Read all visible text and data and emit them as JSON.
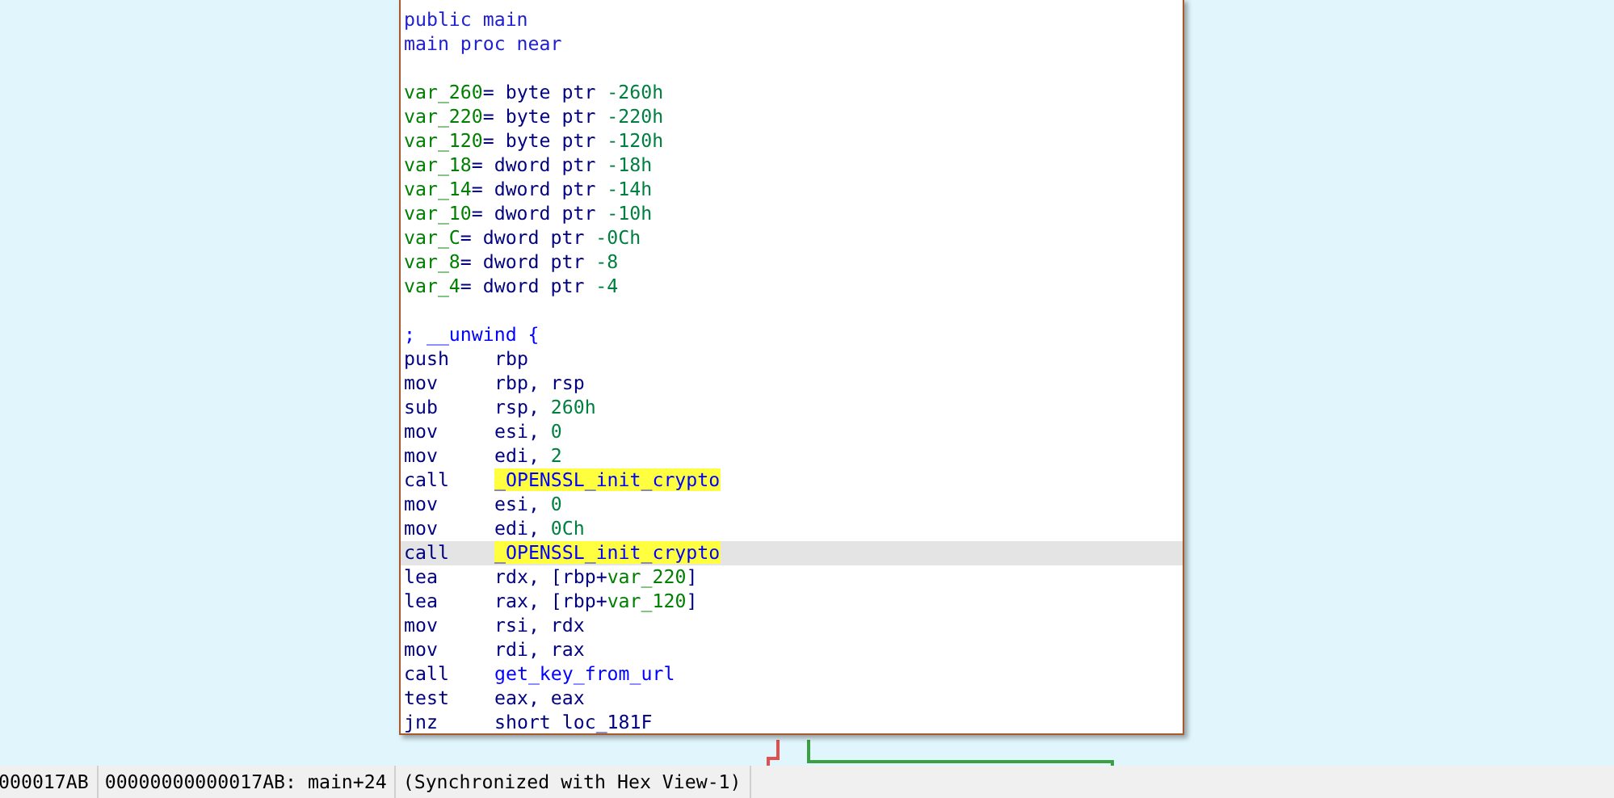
{
  "graph_node": {
    "lines": [
      {
        "kind": "text",
        "selected": false,
        "tokens": [
          {
            "text": "public main",
            "kind": "keyword"
          }
        ]
      },
      {
        "kind": "text",
        "selected": false,
        "tokens": [
          {
            "text": "main proc near",
            "kind": "keyword"
          }
        ]
      },
      {
        "kind": "blank",
        "selected": false
      },
      {
        "kind": "text",
        "selected": false,
        "tokens": [
          {
            "text": "var_260",
            "kind": "name"
          },
          {
            "text": "= byte ptr ",
            "kind": "plain"
          },
          {
            "text": "-260h",
            "kind": "number"
          }
        ]
      },
      {
        "kind": "text",
        "selected": false,
        "tokens": [
          {
            "text": "var_220",
            "kind": "name"
          },
          {
            "text": "= byte ptr ",
            "kind": "plain"
          },
          {
            "text": "-220h",
            "kind": "number"
          }
        ]
      },
      {
        "kind": "text",
        "selected": false,
        "tokens": [
          {
            "text": "var_120",
            "kind": "name"
          },
          {
            "text": "= byte ptr ",
            "kind": "plain"
          },
          {
            "text": "-120h",
            "kind": "number"
          }
        ]
      },
      {
        "kind": "text",
        "selected": false,
        "tokens": [
          {
            "text": "var_18",
            "kind": "name"
          },
          {
            "text": "= dword ptr ",
            "kind": "plain"
          },
          {
            "text": "-18h",
            "kind": "number"
          }
        ]
      },
      {
        "kind": "text",
        "selected": false,
        "tokens": [
          {
            "text": "var_14",
            "kind": "name"
          },
          {
            "text": "= dword ptr ",
            "kind": "plain"
          },
          {
            "text": "-14h",
            "kind": "number"
          }
        ]
      },
      {
        "kind": "text",
        "selected": false,
        "tokens": [
          {
            "text": "var_10",
            "kind": "name"
          },
          {
            "text": "= dword ptr ",
            "kind": "plain"
          },
          {
            "text": "-10h",
            "kind": "number"
          }
        ]
      },
      {
        "kind": "text",
        "selected": false,
        "tokens": [
          {
            "text": "var_C",
            "kind": "name"
          },
          {
            "text": "= dword ptr ",
            "kind": "plain"
          },
          {
            "text": "-0Ch",
            "kind": "number"
          }
        ]
      },
      {
        "kind": "text",
        "selected": false,
        "tokens": [
          {
            "text": "var_8",
            "kind": "name"
          },
          {
            "text": "= dword ptr ",
            "kind": "plain"
          },
          {
            "text": "-8",
            "kind": "number"
          }
        ]
      },
      {
        "kind": "text",
        "selected": false,
        "tokens": [
          {
            "text": "var_4",
            "kind": "name"
          },
          {
            "text": "= dword ptr ",
            "kind": "plain"
          },
          {
            "text": "-4",
            "kind": "number"
          }
        ]
      },
      {
        "kind": "blank",
        "selected": false
      },
      {
        "kind": "text",
        "selected": false,
        "tokens": [
          {
            "text": "; __unwind {",
            "kind": "comment"
          }
        ]
      },
      {
        "kind": "insn",
        "selected": false,
        "mnemonic": "push",
        "tokens": [
          {
            "text": "rbp",
            "kind": "plain"
          }
        ]
      },
      {
        "kind": "insn",
        "selected": false,
        "mnemonic": "mov",
        "tokens": [
          {
            "text": "rbp, rsp",
            "kind": "plain"
          }
        ]
      },
      {
        "kind": "insn",
        "selected": false,
        "mnemonic": "sub",
        "tokens": [
          {
            "text": "rsp, ",
            "kind": "plain"
          },
          {
            "text": "260h",
            "kind": "number"
          }
        ]
      },
      {
        "kind": "insn",
        "selected": false,
        "mnemonic": "mov",
        "tokens": [
          {
            "text": "esi, ",
            "kind": "plain"
          },
          {
            "text": "0",
            "kind": "number"
          }
        ]
      },
      {
        "kind": "insn",
        "selected": false,
        "mnemonic": "mov",
        "tokens": [
          {
            "text": "edi, ",
            "kind": "plain"
          },
          {
            "text": "2",
            "kind": "number"
          }
        ]
      },
      {
        "kind": "insn",
        "selected": false,
        "mnemonic": "call",
        "tokens": [
          {
            "text": "_OPENSSL_init_crypto",
            "kind": "highlighted"
          }
        ]
      },
      {
        "kind": "insn",
        "selected": false,
        "mnemonic": "mov",
        "tokens": [
          {
            "text": "esi, ",
            "kind": "plain"
          },
          {
            "text": "0",
            "kind": "number"
          }
        ]
      },
      {
        "kind": "insn",
        "selected": false,
        "mnemonic": "mov",
        "tokens": [
          {
            "text": "edi, ",
            "kind": "plain"
          },
          {
            "text": "0Ch",
            "kind": "number"
          }
        ]
      },
      {
        "kind": "insn",
        "selected": true,
        "mnemonic": "call",
        "tokens": [
          {
            "text": "_OPENSSL_init_crypto",
            "kind": "highlighted"
          }
        ]
      },
      {
        "kind": "insn",
        "selected": false,
        "mnemonic": "lea",
        "tokens": [
          {
            "text": "rdx, [rbp+",
            "kind": "plain"
          },
          {
            "text": "var_220",
            "kind": "name"
          },
          {
            "text": "]",
            "kind": "plain"
          }
        ]
      },
      {
        "kind": "insn",
        "selected": false,
        "mnemonic": "lea",
        "tokens": [
          {
            "text": "rax, [rbp+",
            "kind": "plain"
          },
          {
            "text": "var_120",
            "kind": "name"
          },
          {
            "text": "]",
            "kind": "plain"
          }
        ]
      },
      {
        "kind": "insn",
        "selected": false,
        "mnemonic": "mov",
        "tokens": [
          {
            "text": "rsi, rdx",
            "kind": "plain"
          }
        ]
      },
      {
        "kind": "insn",
        "selected": false,
        "mnemonic": "mov",
        "tokens": [
          {
            "text": "rdi, rax",
            "kind": "plain"
          }
        ]
      },
      {
        "kind": "insn",
        "selected": false,
        "mnemonic": "call",
        "tokens": [
          {
            "text": "get_key_from_url",
            "kind": "function"
          }
        ]
      },
      {
        "kind": "insn",
        "selected": false,
        "mnemonic": "test",
        "tokens": [
          {
            "text": "eax, eax",
            "kind": "plain"
          }
        ]
      },
      {
        "kind": "insn",
        "selected": false,
        "mnemonic": "jnz",
        "tokens": [
          {
            "text": "short loc_181F",
            "kind": "plain"
          }
        ]
      }
    ]
  },
  "status_bar": [
    "000017AB",
    "00000000000017AB: main+24",
    "(Synchronized with Hex View-1)"
  ]
}
